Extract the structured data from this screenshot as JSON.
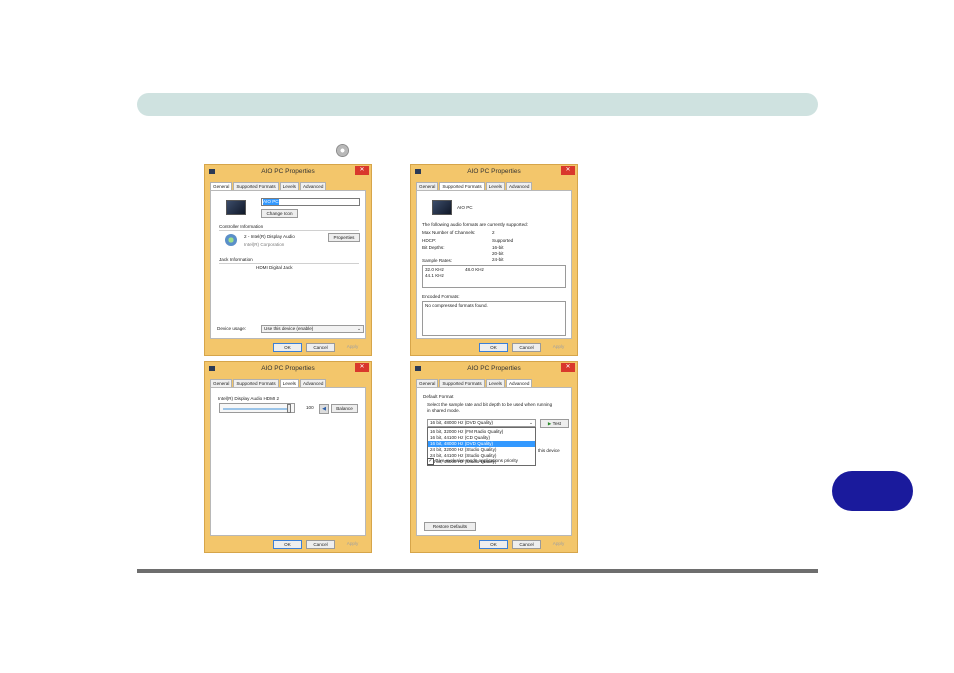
{
  "colors": {
    "header_bar": "#cfe2e0",
    "side_tab": "#1a1a9c",
    "window_frame": "#f3c66b",
    "close_button": "#d9382c",
    "selection": "#3399ff"
  },
  "icons": {
    "disc": "cd-disc-icon",
    "window": "app-window-icon",
    "monitor": "monitor-icon",
    "audio": "audio-device-icon",
    "speaker": "speaker-icon",
    "play": "play-icon"
  },
  "win1": {
    "title": "AIO PC Properties",
    "close": "✕",
    "tabs": [
      "General",
      "Supported Formats",
      "Levels",
      "Advanced"
    ],
    "name_value": "AIO PC",
    "change_icon": "Change Icon",
    "controller_header": "Controller Information",
    "controller_name": "2 - Intel(R) Display Audio",
    "controller_vendor": "Intel(R) Corporation",
    "properties": "Properties",
    "jack_header": "Jack Information",
    "jack_value": "HDMI Digital Jack",
    "device_usage_label": "Device usage:",
    "device_usage_value": "Use this device (enable)",
    "ok": "OK",
    "cancel": "Cancel",
    "apply": "Apply"
  },
  "win2": {
    "title": "AIO PC Properties",
    "close": "✕",
    "tabs": [
      "General",
      "Supported Formats",
      "Levels",
      "Advanced"
    ],
    "device_name": "AIO PC",
    "intro": "The following audio formats are currently supported:",
    "max_channels_label": "Max Number of Channels:",
    "max_channels_value": "2",
    "hdcp_label": "HDCP:",
    "hdcp_value": "Supported",
    "bit_depths_label": "Bit Depths:",
    "bit_depths": [
      "16-bit",
      "20-bit",
      "24-bit"
    ],
    "sample_rates_label": "Sample Rates:",
    "sample_rates": [
      "32.0 KHz",
      "48.0 KHz",
      "44.1 KHz"
    ],
    "encoded_label": "Encoded Formats:",
    "encoded_value": "No compressed formats found.",
    "ok": "OK",
    "cancel": "Cancel",
    "apply": "Apply"
  },
  "win3": {
    "title": "AIO PC Properties",
    "close": "✕",
    "tabs": [
      "General",
      "Supported Formats",
      "Levels",
      "Advanced"
    ],
    "slider_label": "Intel(R) Display Audio HDMI 2",
    "level": 100,
    "level_text": "100",
    "balance": "Balance",
    "ok": "OK",
    "cancel": "Cancel",
    "apply": "Apply"
  },
  "win4": {
    "title": "AIO PC Properties",
    "close": "✕",
    "tabs": [
      "General",
      "Supported Formats",
      "Levels",
      "Advanced"
    ],
    "default_format_header": "Default Format",
    "default_format_desc1": "Select the sample rate and bit depth to be used when running",
    "default_format_desc2": "in shared mode.",
    "selected_format": "16 bit, 48000 Hz (DVD Quality)",
    "test": "Test",
    "options": [
      "16 bit, 32000 Hz (FM Radio Quality)",
      "16 bit, 44100 Hz (CD Quality)",
      "16 bit, 48000 Hz (DVD Quality)",
      "24 bit, 32000 Hz (Studio Quality)",
      "24 bit, 44100 Hz (Studio Quality)",
      "24 bit, 48000 Hz (Studio Quality)"
    ],
    "behind_text": "this device",
    "exclusive_priority": "Give exclusive mode applications priority",
    "restore_defaults": "Restore Defaults",
    "ok": "OK",
    "cancel": "Cancel",
    "apply": "Apply"
  }
}
